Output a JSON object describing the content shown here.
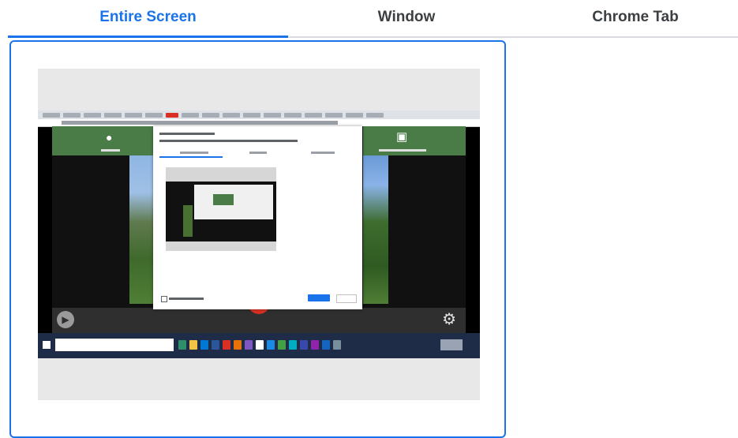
{
  "tabs": [
    {
      "label": "Entire Screen",
      "active": true
    },
    {
      "label": "Window",
      "active": false
    },
    {
      "label": "Chrome Tab",
      "active": false
    }
  ],
  "colors": {
    "accent": "#1a73e8",
    "tab_text": "#3c4043",
    "divider": "#dadce0"
  },
  "preview": {
    "icons": [
      "microphone-icon",
      "screen-share-icon",
      "play-icon",
      "settings-gear-icon",
      "windows-logo-icon"
    ]
  }
}
